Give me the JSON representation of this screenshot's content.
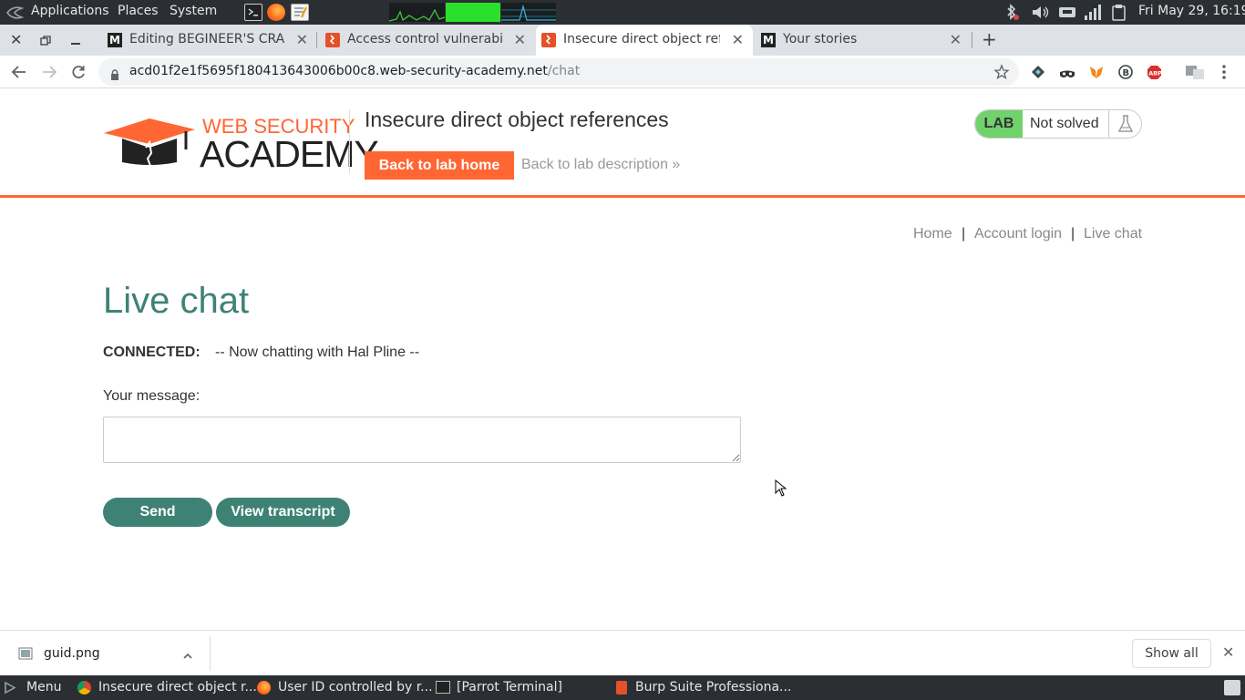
{
  "system_panel": {
    "menus": [
      "Applications",
      "Places",
      "System"
    ],
    "clock": "Fri May 29, 16:19"
  },
  "browser": {
    "tabs": [
      {
        "label": "Editing BEGINEER'S CRA",
        "favicon": "medium-icon",
        "active": false
      },
      {
        "label": "Access control vulnerabili",
        "favicon": "portswigger-icon",
        "active": false
      },
      {
        "label": "Insecure direct object refe",
        "favicon": "portswigger-icon",
        "active": true
      },
      {
        "label": "Your stories",
        "favicon": "medium-icon",
        "active": false
      }
    ],
    "url_host": "acd01f2e1f5695f180413643006b00c8.web-security-academy.net",
    "url_path": "/chat"
  },
  "lab": {
    "title": "Insecure direct object references",
    "back_home": "Back to lab home",
    "back_description": "Back to lab description",
    "badge_label": "LAB",
    "status": "Not solved",
    "logo_top": "WEB SECURITY",
    "logo_bottom": "ACADEMY"
  },
  "nav": {
    "home": "Home",
    "separator": "|",
    "account_login": "Account login",
    "live_chat": "Live chat"
  },
  "chat": {
    "heading": "Live chat",
    "connected_label": "CONNECTED:",
    "system_message": "-- Now chatting with Hal Pline --",
    "message_label": "Your message:",
    "message_value": "",
    "send_label": "Send",
    "transcript_label": "View transcript"
  },
  "downloads": {
    "file_name": "guid.png",
    "show_all": "Show all"
  },
  "taskbar": {
    "menu": "Menu",
    "items": [
      "Insecure direct object r...",
      "User ID controlled by r...",
      "[Parrot Terminal]",
      "Burp Suite Professiona..."
    ]
  },
  "colors": {
    "accent_orange": "#ff6633",
    "accent_teal": "#3e8275",
    "lab_green": "#70d16d"
  }
}
